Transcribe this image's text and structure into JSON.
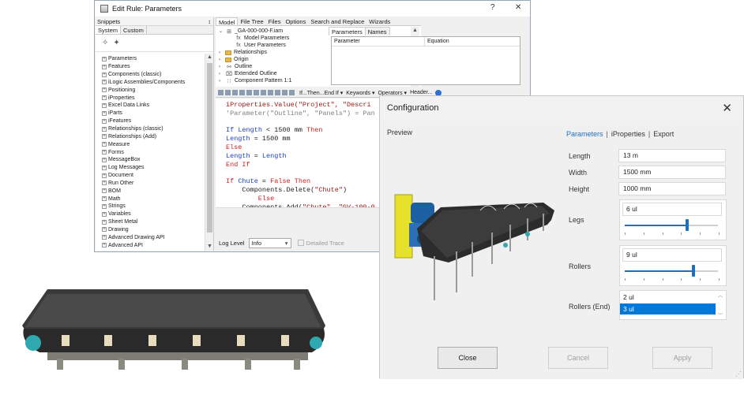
{
  "edit_rule": {
    "title": "Edit Rule: Parameters",
    "help_label": "?",
    "close_label": "✕",
    "snippets_header": "Snippets",
    "snippets_pin": "↕",
    "snippet_tabs": [
      "System",
      "Custom"
    ],
    "snippet_items": [
      "Parameters",
      "Features",
      "Components (classic)",
      "iLogic Assemblies/Components",
      "Positioning",
      "iProperties",
      "Excel Data Links",
      "iParts",
      "iFeatures",
      "Relationships (classic)",
      "Relationships (Add)",
      "Measure",
      "Forms",
      "MessageBox",
      "Log Messages",
      "Document",
      "Run Other",
      "BOM",
      "Math",
      "Strings",
      "Variables",
      "Sheet Metal",
      "Drawing",
      "Advanced Drawing API",
      "Advanced API"
    ],
    "tree_tabs": [
      "Model",
      "File Tree",
      "Files",
      "Options",
      "Search and Replace",
      "Wizards"
    ],
    "tree_items": [
      {
        "arrow": "⌄",
        "icon": "⊞",
        "label": "_GA-000-000-F.iam"
      },
      {
        "arrow": "",
        "icon": "fx",
        "label": "Model Parameters"
      },
      {
        "arrow": "",
        "icon": "fx",
        "label": "User Parameters"
      },
      {
        "arrow": "›",
        "icon": "folder",
        "label": "Relationships"
      },
      {
        "arrow": "›",
        "icon": "folder",
        "label": "Origin"
      },
      {
        "arrow": "›",
        "icon": "⚯",
        "label": "Outline"
      },
      {
        "arrow": "›",
        "icon": "⌧",
        "label": "Extended Outline"
      },
      {
        "arrow": "›",
        "icon": "∷",
        "label": "Component Pattern 1:1"
      }
    ],
    "param_tabs": [
      "Parameters",
      "Names"
    ],
    "param_columns": [
      "Parameter",
      "Equation"
    ],
    "toolbar_items": [
      "If...Then...End If ▾",
      "Keywords ▾",
      "Operators ▾",
      "Header..."
    ],
    "code": {
      "l1_a": "iProperties.Value(\"Project\", \"Descri",
      "l2_a": "'Parameter(\"Outline\", \"Panels\") = Pan",
      "l4_kw1": "If ",
      "l4_var": "Length",
      "l4_rest": " < 1500 mm ",
      "l4_kw2": "Then",
      "l5_var": "Length",
      "l5_rest": " = 1500 mm",
      "l6_kw": "Else",
      "l7_var1": "Length",
      "l7_mid": " = ",
      "l7_var2": "Length",
      "l8_kw": "End If",
      "l10_kw1": "If ",
      "l10_var": "Chute",
      "l10_mid": " = ",
      "l10_kw2": "False Then",
      "l11_fn": "    Components.Delete(",
      "l11_str": "\"Chute\"",
      "l11_end": ")",
      "l12_kw": "        Else",
      "l13_fn": "    Components.Add(",
      "l13_str": "\"Chute\", \"GV-100-0"
    },
    "log_level_label": "Log Level",
    "log_level_value": "Info",
    "detailed_trace_label": "Detailed Trace"
  },
  "config": {
    "title": "Configuration",
    "close_label": "✕",
    "preview_label": "Preview",
    "tabs": [
      "Parameters",
      "iProperties",
      "Export"
    ],
    "tab_separator": "|",
    "length_label": "Length",
    "length_value": "13 m",
    "width_label": "Width",
    "width_value": "1500 mm",
    "height_label": "Height",
    "height_value": "1000 mm",
    "legs_label": "Legs",
    "legs_value": "6 ul",
    "legs_level": 0.67,
    "rollers_label": "Rollers",
    "rollers_value": "9 ul",
    "rollers_level": 0.74,
    "rollers_end_label": "Rollers (End)",
    "rollers_end_options": [
      "2 ul",
      "3 ul"
    ],
    "rollers_end_selected": "3 ul",
    "buttons": {
      "close": "Close",
      "cancel": "Cancel",
      "apply": "Apply"
    },
    "accent_color": "#1f6fbf",
    "selection_color": "#0078d7"
  }
}
